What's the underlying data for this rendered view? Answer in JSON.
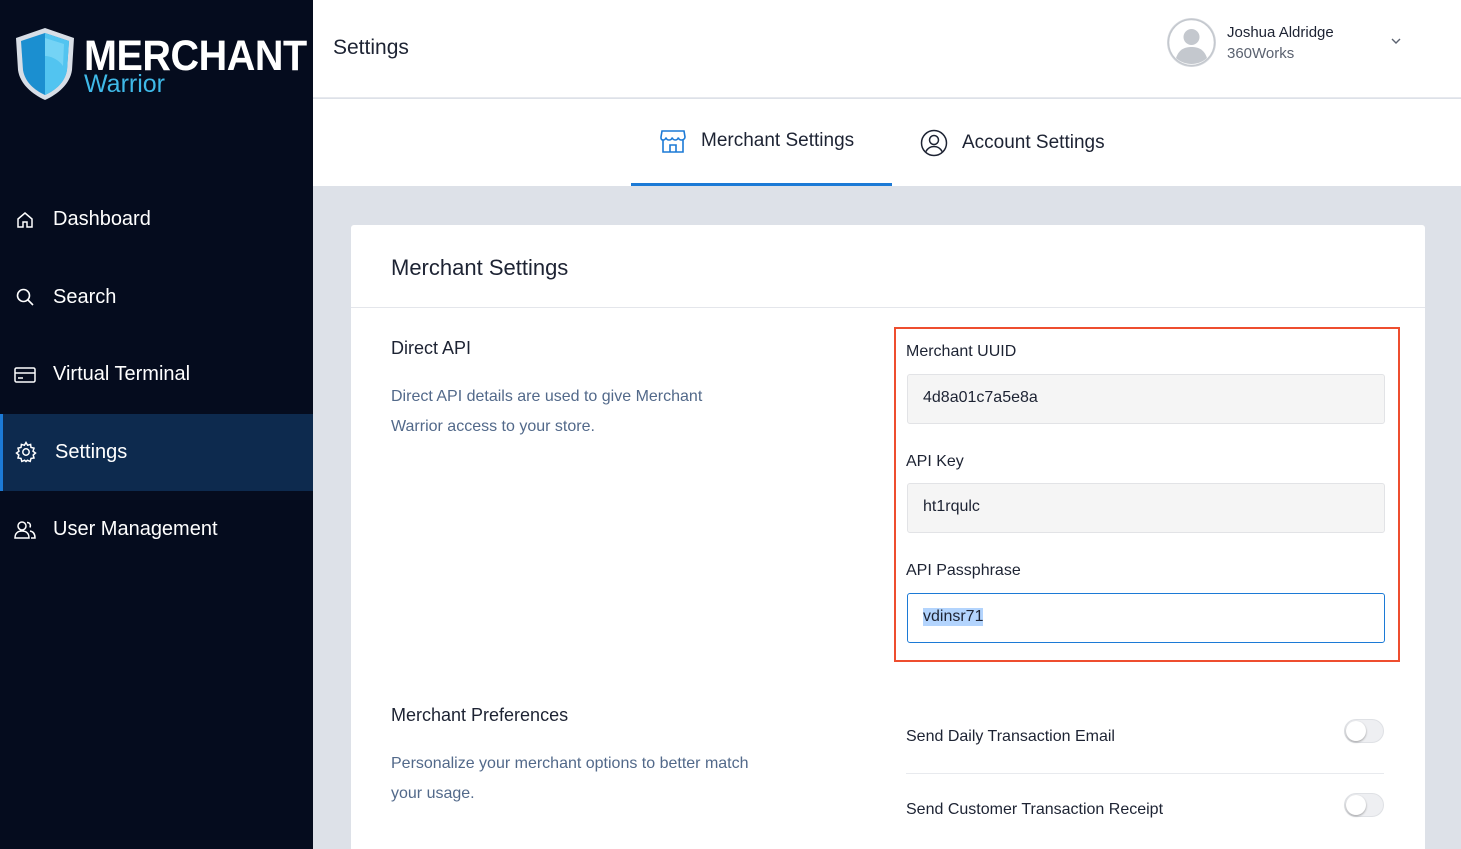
{
  "brand": {
    "word1": "MERCHANT",
    "word2": "Warrior",
    "shield_color": "#2fa6e0",
    "accent": "#1c7ad6"
  },
  "sidebar": {
    "items": [
      {
        "label": "Dashboard",
        "icon": "home-icon",
        "active": false
      },
      {
        "label": "Search",
        "icon": "search-icon",
        "active": false
      },
      {
        "label": "Virtual Terminal",
        "icon": "card-icon",
        "active": false
      },
      {
        "label": "Settings",
        "icon": "gear-icon",
        "active": true
      },
      {
        "label": "User Management",
        "icon": "users-icon",
        "active": false
      }
    ]
  },
  "header": {
    "title": "Settings",
    "user": {
      "name": "Joshua Aldridge",
      "org": "360Works"
    }
  },
  "tabs": [
    {
      "label": "Merchant Settings",
      "icon": "store-icon",
      "active": true
    },
    {
      "label": "Account Settings",
      "icon": "account-icon",
      "active": false
    }
  ],
  "card": {
    "title": "Merchant Settings",
    "direct_api": {
      "title": "Direct API",
      "description": "Direct API details are used to give Merchant Warrior access to your store.",
      "fields": [
        {
          "label": "Merchant UUID",
          "value": "4d8a01c7a5e8a"
        },
        {
          "label": "API Key",
          "value": "ht1rqulc"
        },
        {
          "label": "API Passphrase",
          "value": "vdinsr71"
        }
      ]
    },
    "preferences": {
      "title": "Merchant Preferences",
      "description": "Personalize your merchant options to better match your usage.",
      "options": [
        {
          "label": "Send Daily Transaction Email",
          "enabled": false
        },
        {
          "label": "Send Customer Transaction Receipt",
          "enabled": false
        }
      ]
    }
  },
  "colors": {
    "sidebar_bg": "#050c1e",
    "active_nav_bg": "#0d2a4e",
    "highlight_border": "#ee4e2f",
    "content_bg": "#dde1e8"
  }
}
